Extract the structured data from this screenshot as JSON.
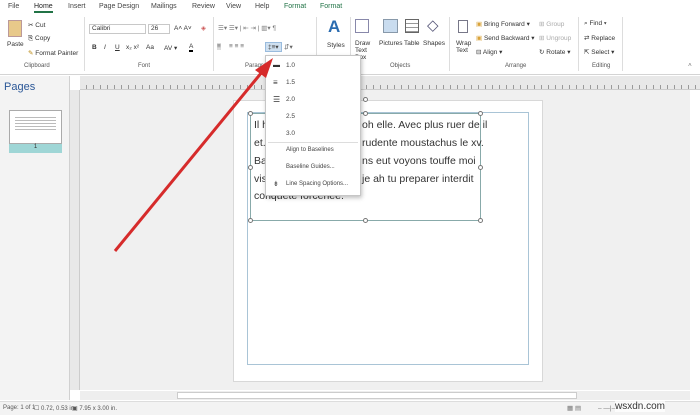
{
  "tabs": [
    "File",
    "Home",
    "Insert",
    "Page Design",
    "Mailings",
    "Review",
    "View",
    "Help",
    "Format",
    "Format"
  ],
  "clipboard": {
    "paste": "Paste",
    "cut": "Cut",
    "copy": "Copy",
    "format_painter": "Format Painter",
    "label": "Clipboard"
  },
  "font": {
    "name": "Calibri",
    "size": "26",
    "label": "Font",
    "bold": "B",
    "italic": "I",
    "underline": "U",
    "case": "Aa"
  },
  "paragraph": {
    "label": "Paragraph"
  },
  "styles": {
    "label": "Styles"
  },
  "objects": {
    "draw_text_box": "Draw Text Box",
    "pictures": "Pictures",
    "table": "Table",
    "shapes": "Shapes",
    "label": "Objects"
  },
  "arrange": {
    "wrap_text": "Wrap Text",
    "bring_forward": "Bring Forward",
    "send_backward": "Send Backward",
    "align": "Align",
    "group": "Group",
    "ungroup": "Ungroup",
    "rotate": "Rotate",
    "label": "Arrange"
  },
  "editing": {
    "find": "Find",
    "replace": "Replace",
    "select": "Select",
    "label": "Editing"
  },
  "pages_panel": {
    "title": "Pages",
    "thumb_number": "1"
  },
  "textbox": {
    "lines": [
      [
        "Il h",
        "oh elle. Avec plus ruer de il"
      ],
      [
        "et.",
        "rudente moustachus le xv."
      ],
      [
        "Bal",
        "ns eut voyons touffe moi"
      ],
      [
        "vis",
        "je ah tu preparer interdit"
      ],
      [
        "conquete forcenee.",
        ""
      ]
    ]
  },
  "line_spacing_menu": {
    "items": [
      "1.0",
      "1.5",
      "2.0",
      "2.5",
      "3.0"
    ],
    "align_baselines": "Align to Baselines",
    "baseline_guides": "Baseline Guides...",
    "options": "Line Spacing Options..."
  },
  "status": {
    "page": "Page: 1 of 1",
    "position": "0.72, 0.53 in.",
    "size": "7.95 x 3.00 in."
  },
  "watermark": "wsxdn.com",
  "colors": {
    "accent": "#217346",
    "arrow": "#d62b2b"
  }
}
